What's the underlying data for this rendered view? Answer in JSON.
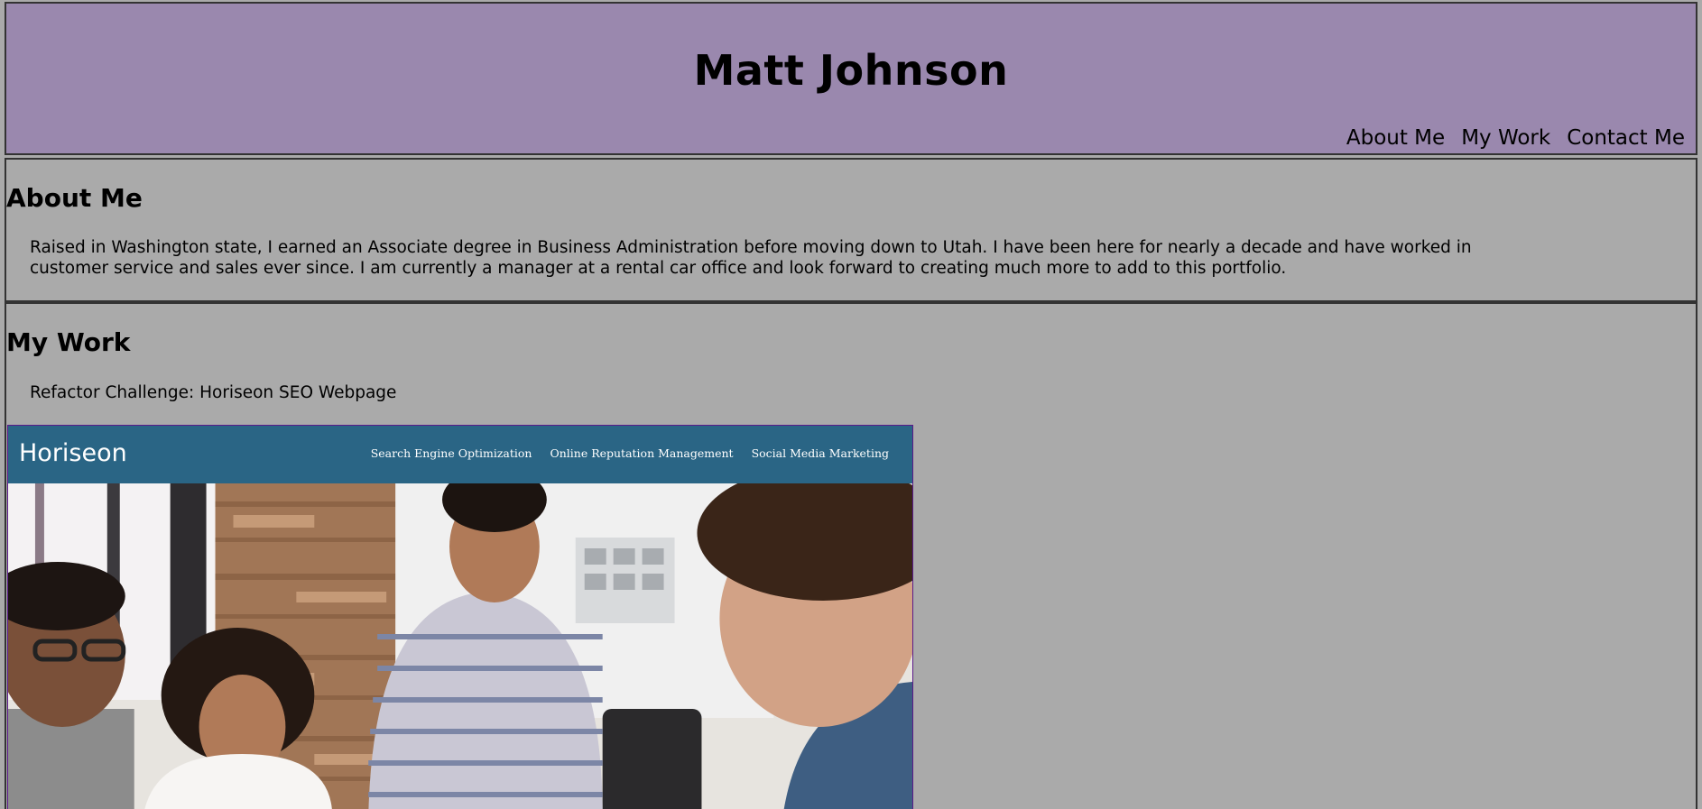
{
  "header": {
    "title": "Matt Johnson",
    "nav": [
      "About Me",
      "My Work",
      "Contact Me"
    ]
  },
  "about": {
    "heading": "About Me",
    "body": "Raised in Washington state, I earned an Associate degree in Business Administration before moving down to Utah. I have been here for nearly a decade and have worked in customer service and sales ever since. I am currently a manager at a rental car office and look forward to creating much more to add to this portfolio."
  },
  "work": {
    "heading": "My Work",
    "items": [
      {
        "label": "Refactor Challenge: Horiseon SEO Webpage",
        "thumbnail": {
          "logo": "Horiseon",
          "links": [
            "Search Engine Optimization",
            "Online Reputation Management",
            "Social Media Marketing"
          ]
        }
      }
    ]
  },
  "colors": {
    "page_bg": "#aaaaaa",
    "header_bg": "#9a88ae",
    "border": "#333333",
    "thumb_nav_bg": "#2a6585",
    "thumb_border": "#5b1a8a"
  }
}
